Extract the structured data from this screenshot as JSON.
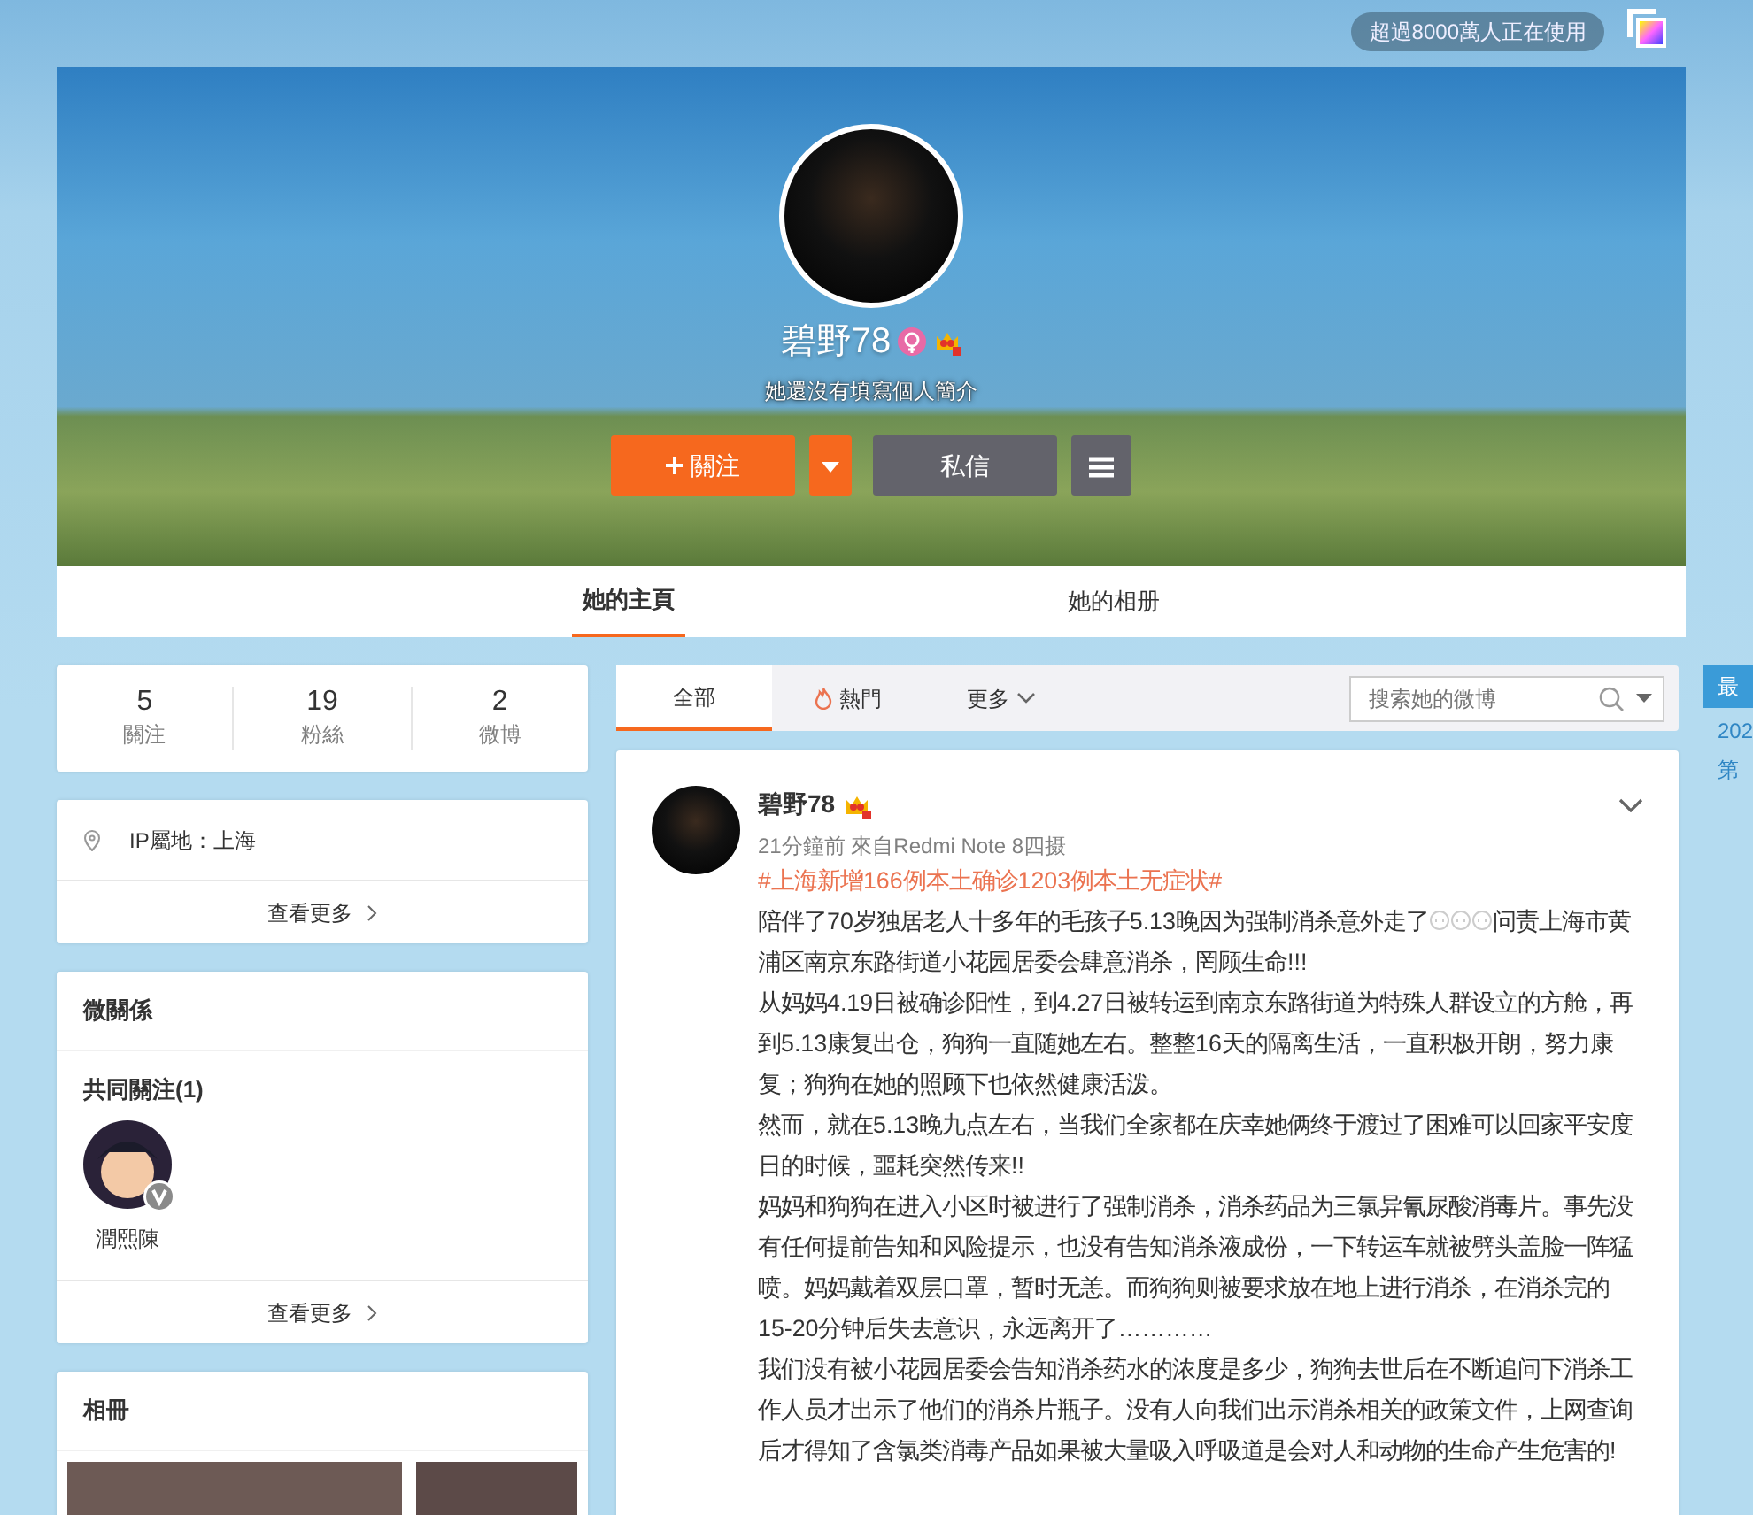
{
  "usage_badge": "超過8000萬人正在使用",
  "profile": {
    "name": "碧野78",
    "female": true,
    "bio": "她還沒有填寫個人簡介",
    "follow_button": "關注",
    "message_button": "私信"
  },
  "profile_tabs": [
    {
      "label": "她的主頁",
      "selected": true
    },
    {
      "label": "她的相册",
      "selected": false
    }
  ],
  "stats": [
    {
      "value": "5",
      "label": "關注"
    },
    {
      "value": "19",
      "label": "粉絲"
    },
    {
      "value": "2",
      "label": "微博"
    }
  ],
  "info": {
    "ip_location": "IP屬地：上海",
    "more": "查看更多"
  },
  "relations": {
    "title": "微關係",
    "subtitle": "共同關注(1)",
    "people": [
      {
        "name": "潤熙陳",
        "verified": true
      }
    ],
    "more": "查看更多"
  },
  "album": {
    "title": "相冊"
  },
  "feed_tabs": [
    {
      "label": "全部",
      "kind": "plain",
      "selected": true
    },
    {
      "label": "熱門",
      "kind": "hot",
      "selected": false
    },
    {
      "label": "更多",
      "kind": "dropdown",
      "selected": false
    }
  ],
  "search": {
    "placeholder": "搜索她的微博"
  },
  "post": {
    "author": "碧野78",
    "meta": "21分鐘前 來自Redmi Note 8四摄",
    "topic": "#上海新增166例本土确诊1203例本土无症状#",
    "paragraphs": [
      {
        "text": "陪伴了70岁独居老人十多年的毛孩子5.13晚因为强制消杀意外走了",
        "emoji": [
          {
            "kind": "tear"
          },
          {
            "kind": "tear"
          },
          {
            "kind": "tear"
          }
        ],
        "rest": "问责上海市黄浦区南京东路街道小花园居委会肆意消杀，罔顾生命!!!"
      },
      {
        "text": "从妈妈4.19日被确诊阳性，到4.27日被转运到南京东路街道为特殊人群设立的方舱，再到5.13康复出仓，狗狗一直随她左右。整整16天的隔离生活，一直积极开朗，努力康复；狗狗在她的照顾下也依然健康活泼。"
      },
      {
        "text": "然而，就在5.13晚九点左右，当我们全家都在庆幸她俩终于渡过了困难可以回家平安度日的时候，噩耗突然传来!!"
      },
      {
        "text": "妈妈和狗狗在进入小区时被进行了强制消杀，消杀药品为三氯异氰尿酸消毒片。事先没有任何提前告知和风险提示，也没有告知消杀液成份，一下转运车就被劈头盖脸一阵猛喷。妈妈戴着双层口罩，暂时无恙。而狗狗则被要求放在地上进行消杀，在消杀完的15-20分钟后失去意识，永远离开了…………"
      },
      {
        "text": "我们没有被小花园居委会告知消杀药水的浓度是多少，狗狗去世后在不断追问下消杀工作人员才出示了他们的消杀片瓶子。没有人向我们出示消杀相关的政策文件，上网查询后才得知了含氯类消毒产品如果被大量吸入呼吸道是会对人和动物的生命产生危害的!"
      }
    ]
  },
  "right_rail": {
    "title": "最",
    "items": [
      "202",
      "第"
    ]
  }
}
